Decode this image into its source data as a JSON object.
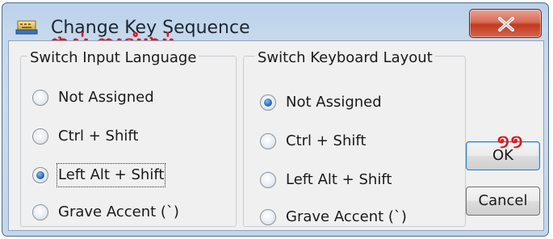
{
  "window": {
    "title": "Change Key Sequence",
    "annotation_khmer": "ផ្លាស់ ការលំដាប់"
  },
  "input_language": {
    "group_title": "Switch Input Language",
    "options": [
      "Not Assigned",
      "Ctrl + Shift",
      "Left Alt + Shift",
      "Grave Accent (`)"
    ],
    "selected": "Left Alt + Shift"
  },
  "keyboard_layout": {
    "group_title": "Switch Keyboard Layout",
    "options": [
      "Not Assigned",
      "Ctrl + Shift",
      "Left Alt + Shift",
      "Grave Accent (`)"
    ],
    "selected": "Not Assigned"
  },
  "buttons": {
    "ok": "OK",
    "cancel": "Cancel",
    "ok_annotation": "១១"
  },
  "colors": {
    "annotation": "#e01818",
    "close_button": "#c2391f",
    "radio_selected": "#2c6fc6"
  }
}
